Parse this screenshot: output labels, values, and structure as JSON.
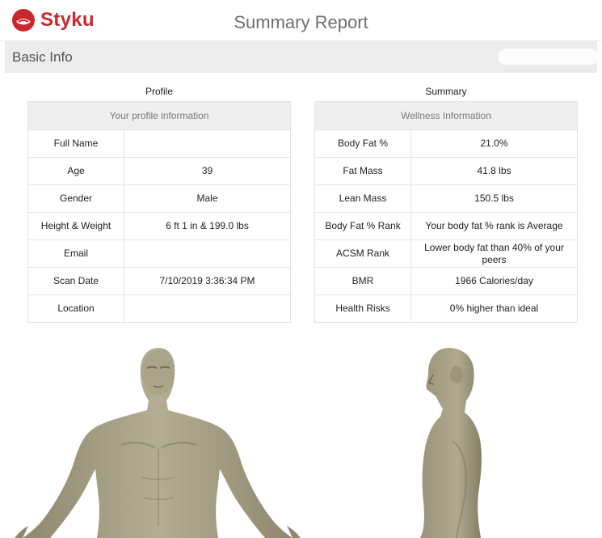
{
  "header": {
    "logo_text": "Styku",
    "title": "Summary Report"
  },
  "basic_info": {
    "title": "Basic Info"
  },
  "profile": {
    "section_label": "Profile",
    "table_header": "Your profile information",
    "rows": [
      {
        "label": "Full Name",
        "value": ""
      },
      {
        "label": "Age",
        "value": "39"
      },
      {
        "label": "Gender",
        "value": "Male"
      },
      {
        "label": "Height & Weight",
        "value": "6 ft 1 in & 199.0 lbs"
      },
      {
        "label": "Email",
        "value": ""
      },
      {
        "label": "Scan Date",
        "value": "7/10/2019 3:36:34 PM"
      },
      {
        "label": "Location",
        "value": ""
      }
    ]
  },
  "summary": {
    "section_label": "Summary",
    "table_header": "Wellness Information",
    "rows": [
      {
        "label": "Body Fat %",
        "value": "21.0%"
      },
      {
        "label": "Fat Mass",
        "value": "41.8 lbs"
      },
      {
        "label": "Lean Mass",
        "value": "150.5 lbs"
      },
      {
        "label": "Body Fat % Rank",
        "value": "Your body fat % rank is Average"
      },
      {
        "label": "ACSM Rank",
        "value": "Lower body fat than 40% of your peers"
      },
      {
        "label": "BMR",
        "value": "1966 Calories/day"
      },
      {
        "label": "Health Risks",
        "value": "0% higher than ideal"
      }
    ]
  },
  "colors": {
    "brand": "#c8282e",
    "band": "#ececec",
    "avatar": "#a49d84"
  }
}
